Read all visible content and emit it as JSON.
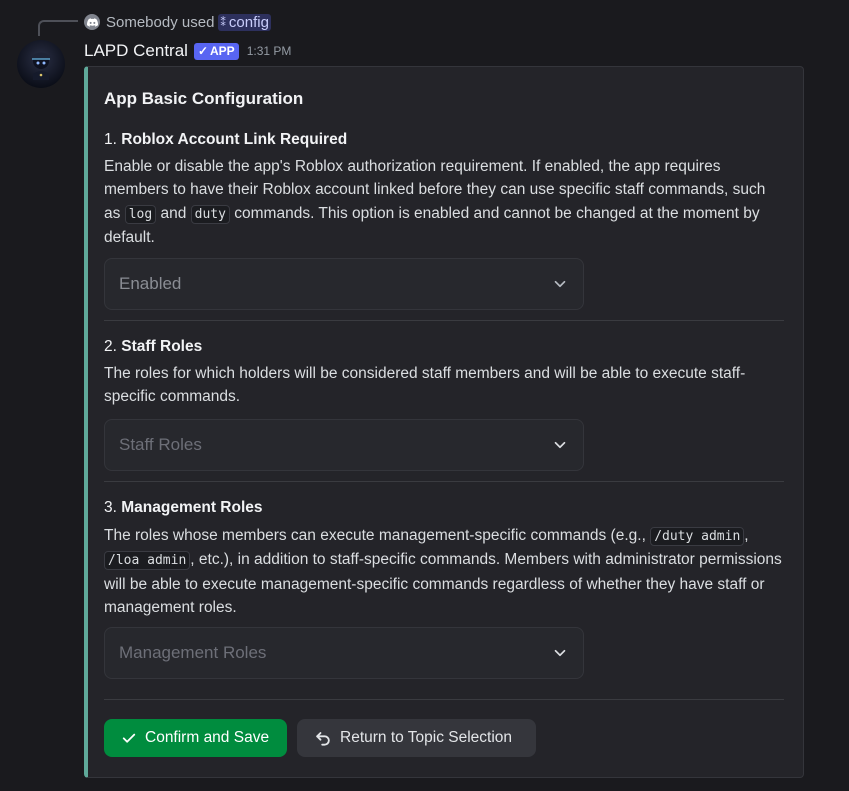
{
  "reply": {
    "user_text": "Somebody used",
    "command": "config"
  },
  "message": {
    "author": "LAPD Central",
    "badge": "APP",
    "timestamp": "1:31 PM"
  },
  "embed": {
    "accent_color": "#5fa99a",
    "title": "App Basic Configuration",
    "sections": [
      {
        "num": "1.",
        "heading": "Roblox Account Link Required",
        "desc_parts": [
          "Enable or disable the app's Roblox authorization requirement. If enabled, the app requires members to have their Roblox account linked before they can use specific staff commands, such as ",
          "log",
          " and ",
          "duty",
          " commands. This option is enabled and cannot be changed at the moment by default."
        ],
        "select_value": "Enabled"
      },
      {
        "num": "2.",
        "heading": "Staff Roles",
        "desc_parts": [
          "The roles for which holders will be considered staff members and will be able to execute staff-specific commands."
        ],
        "select_placeholder": "Staff Roles"
      },
      {
        "num": "3.",
        "heading": "Management Roles",
        "desc_parts": [
          "The roles whose members can execute management-specific commands (e.g., ",
          "/duty admin",
          ", ",
          "/loa admin",
          ", etc.), in addition to staff-specific commands. Members with administrator permissions will be able to execute management-specific commands regardless of whether they have staff or management roles."
        ],
        "select_placeholder": "Management Roles"
      }
    ],
    "buttons": {
      "confirm": "Confirm and Save",
      "return": "Return to Topic Selection"
    }
  },
  "colors": {
    "primary_button": "#008c3e",
    "badge": "#5865f2"
  }
}
